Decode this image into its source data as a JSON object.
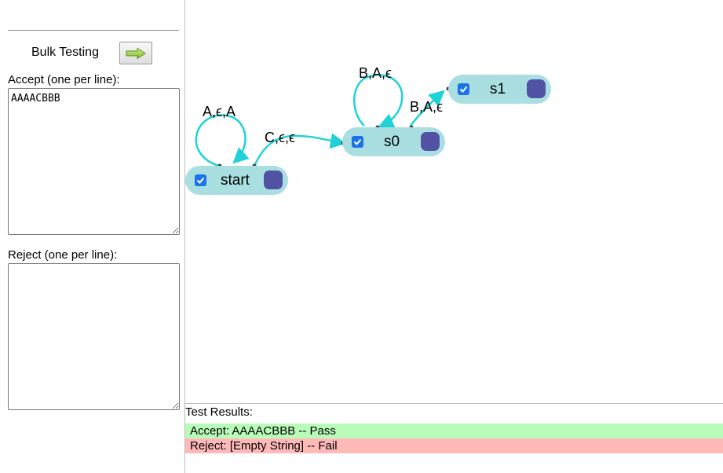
{
  "sidebar": {
    "bulk_testing_label": "Bulk Testing",
    "bulk_button_icon": "right-arrow-icon",
    "accept_label": "Accept (one per line):",
    "accept_value": "AAAACBBB",
    "reject_label": "Reject (one per line):",
    "reject_value": ""
  },
  "automaton": {
    "states": [
      {
        "name": "start",
        "checked": true
      },
      {
        "name": "s0",
        "checked": true
      },
      {
        "name": "s1",
        "checked": true
      }
    ],
    "transitions": [
      {
        "from": "start",
        "to": "start",
        "label": "A,ϵ,A"
      },
      {
        "from": "start",
        "to": "s0",
        "label": "C,ϵ,ϵ"
      },
      {
        "from": "s0",
        "to": "s0",
        "label": "B,A,ϵ"
      },
      {
        "from": "s0",
        "to": "s1",
        "label": "B,A,ϵ"
      }
    ],
    "colors": {
      "state_fill": "#a9dfe0",
      "final_marker": "#5152a3",
      "edge": "#1ed2d8"
    }
  },
  "results": {
    "label": "Test Results:",
    "rows": [
      {
        "text": "Accept: AAAACBBB -- Pass",
        "status": "pass",
        "color": "#b9fbb9"
      },
      {
        "text": "Reject: [Empty String] -- Fail",
        "status": "fail",
        "color": "#ffb9b9"
      }
    ]
  }
}
